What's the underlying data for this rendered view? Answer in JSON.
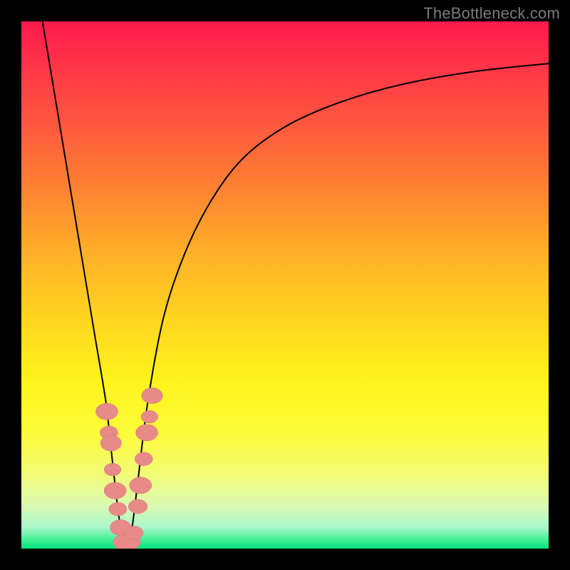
{
  "watermark": "TheBottleneck.com",
  "colors": {
    "frame": "#000000",
    "gradient_top": "#ff1a4d",
    "gradient_bottom": "#00e57a",
    "curve_stroke": "#000000",
    "marker_fill": "#e78a88"
  },
  "chart_data": {
    "type": "line",
    "title": "",
    "xlabel": "",
    "ylabel": "",
    "xlim": [
      0,
      100
    ],
    "ylim": [
      0,
      100
    ],
    "grid": false,
    "legend": false,
    "series": [
      {
        "name": "bottleneck-curve",
        "x": [
          4,
          6,
          8,
          10,
          12,
          14,
          16,
          17,
          18,
          18.8,
          19.5,
          20.2,
          21,
          22,
          24,
          27,
          31,
          36,
          42,
          50,
          60,
          72,
          86,
          100
        ],
        "y": [
          100,
          88,
          76,
          64,
          52,
          40,
          28,
          19,
          10,
          4,
          0.5,
          1,
          4,
          12,
          28,
          44,
          56,
          66,
          74,
          80,
          84.5,
          88,
          90.5,
          92
        ]
      }
    ],
    "markers": {
      "name": "highlight-points",
      "groups": [
        {
          "name": "left-cluster",
          "points": [
            {
              "x": 16.2,
              "y": 26,
              "r": 2.1
            },
            {
              "x": 16.6,
              "y": 22,
              "r": 1.7
            },
            {
              "x": 17.0,
              "y": 20,
              "r": 2.0
            },
            {
              "x": 17.3,
              "y": 15,
              "r": 1.6
            },
            {
              "x": 17.8,
              "y": 11,
              "r": 2.1
            },
            {
              "x": 18.3,
              "y": 7.5,
              "r": 1.7
            },
            {
              "x": 18.8,
              "y": 4,
              "r": 2.0
            }
          ]
        },
        {
          "name": "bottom-cluster",
          "points": [
            {
              "x": 19.3,
              "y": 1.2,
              "r": 1.9
            },
            {
              "x": 19.9,
              "y": 0.6,
              "r": 1.8
            },
            {
              "x": 20.6,
              "y": 1.3,
              "r": 2.0
            },
            {
              "x": 21.4,
              "y": 3.0,
              "r": 1.7
            }
          ]
        },
        {
          "name": "right-cluster",
          "points": [
            {
              "x": 22.1,
              "y": 8,
              "r": 1.8
            },
            {
              "x": 22.6,
              "y": 12,
              "r": 2.1
            },
            {
              "x": 23.2,
              "y": 17,
              "r": 1.7
            },
            {
              "x": 23.8,
              "y": 22,
              "r": 2.1
            },
            {
              "x": 24.3,
              "y": 25,
              "r": 1.6
            },
            {
              "x": 24.8,
              "y": 29,
              "r": 2.0
            }
          ]
        }
      ]
    }
  }
}
